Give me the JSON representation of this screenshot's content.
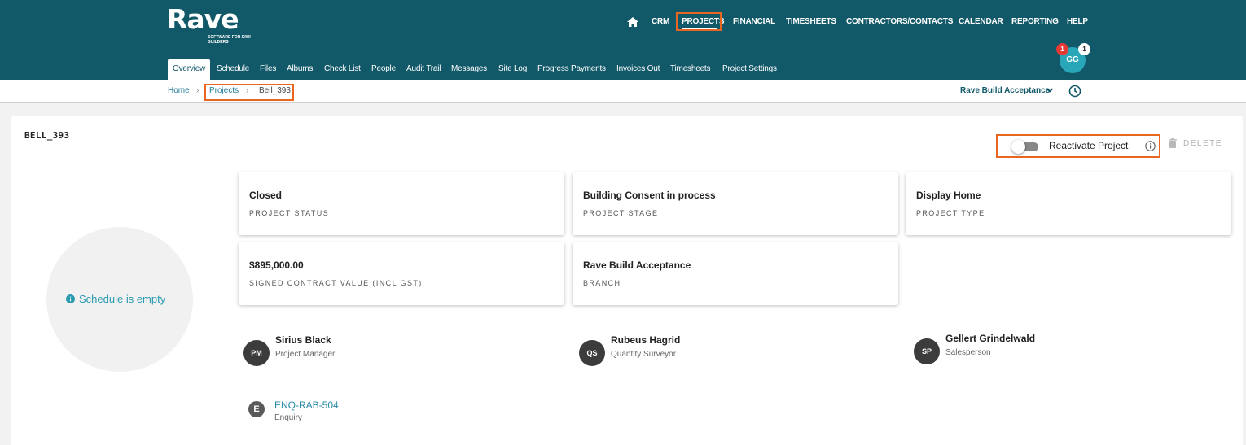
{
  "brand": {
    "name": "Rave",
    "tagline": "SOFTWARE FOR KIWI BUILDERS"
  },
  "nav": {
    "home_icon": "home-icon",
    "items": [
      "CRM",
      "PROJECTS",
      "FINANCIAL",
      "TIMESHEETS",
      "CONTRACTORS/CONTACTS",
      "CALENDAR",
      "REPORTING",
      "HELP"
    ],
    "active": "PROJECTS"
  },
  "subtabs": {
    "items": [
      "Overview",
      "Schedule",
      "Files",
      "Albums",
      "Check List",
      "People",
      "Audit Trail",
      "Messages",
      "Site Log",
      "Progress Payments",
      "Invoices Out",
      "Timesheets",
      "Project Settings"
    ],
    "active": "Overview"
  },
  "user": {
    "initials": "GG",
    "notifications_red": "1",
    "notifications_white": "1"
  },
  "breadcrumb": {
    "home": "Home",
    "projects": "Projects",
    "current": "Bell_393"
  },
  "branch_selector": {
    "value": "Rave Build Acceptance"
  },
  "project": {
    "code": "BELL_393",
    "reactivate_label": "Reactivate Project",
    "reactivate_on": false,
    "delete_label": "DELETE",
    "schedule_empty": "Schedule is empty",
    "info": [
      {
        "value": "Closed",
        "label": "PROJECT STATUS"
      },
      {
        "value": "Building Consent in process",
        "label": "PROJECT STAGE"
      },
      {
        "value": "Display Home",
        "label": "PROJECT TYPE"
      },
      {
        "value": "$895,000.00",
        "label": "SIGNED CONTRACT VALUE (INCL GST)"
      },
      {
        "value": "Rave Build Acceptance",
        "label": "BRANCH"
      }
    ],
    "people": [
      {
        "initials": "PM",
        "name": "Sirius Black",
        "role": "Project Manager"
      },
      {
        "initials": "QS",
        "name": "Rubeus Hagrid",
        "role": "Quantity Surveyor"
      },
      {
        "initials": "SP",
        "name": "Gellert Grindelwald",
        "role": "Salesperson"
      }
    ],
    "enquiry": {
      "icon_letter": "E",
      "code": "ENQ-RAB-504",
      "label": "Enquiry"
    }
  },
  "colors": {
    "header_bg": "#115868",
    "highlight": "#e8661f",
    "link": "#1f7a99"
  }
}
